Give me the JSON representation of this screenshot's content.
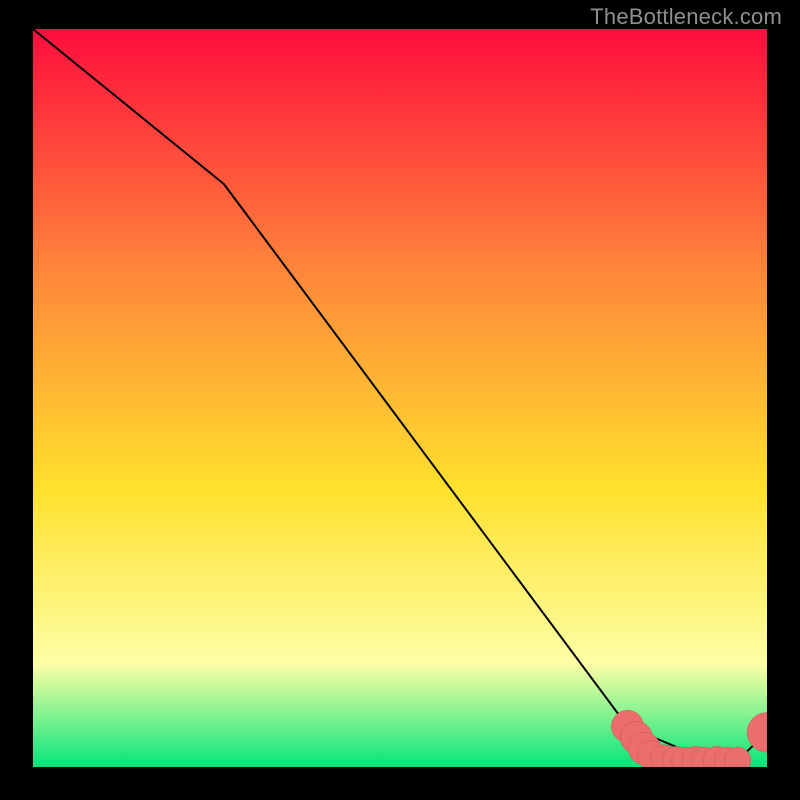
{
  "watermark": "TheBottleneck.com",
  "colors": {
    "gradient_top": "#ff0e3d",
    "gradient_mid_upper": "#ff8d3a",
    "gradient_mid": "#ffe02c",
    "gradient_mid_lower": "#fdffa5",
    "gradient_bottom": "#05e57a",
    "curve": "#000000",
    "marker_fill": "#ec6e6c",
    "marker_stroke": "#c95452",
    "frame_bg": "#000000"
  },
  "chart_data": {
    "type": "line",
    "title": "",
    "xlabel": "",
    "ylabel": "",
    "xlim": [
      0,
      100
    ],
    "ylim": [
      0,
      100
    ],
    "series": [
      {
        "name": "bottleneck-curve",
        "x": [
          0,
          26,
          81,
          92,
          96,
          100
        ],
        "y": [
          100,
          79,
          5.5,
          0.9,
          0.9,
          4.7
        ]
      }
    ],
    "markers": [
      {
        "x": 81.0,
        "y": 5.5,
        "r": 2.2
      },
      {
        "x": 82.2,
        "y": 4.0,
        "r": 2.2
      },
      {
        "x": 83.3,
        "y": 2.5,
        "r": 2.2
      },
      {
        "x": 84.3,
        "y": 1.6,
        "r": 2.0
      },
      {
        "x": 86.0,
        "y": 1.1,
        "r": 1.9
      },
      {
        "x": 87.6,
        "y": 0.9,
        "r": 1.9
      },
      {
        "x": 88.8,
        "y": 0.9,
        "r": 1.8
      },
      {
        "x": 90.3,
        "y": 0.9,
        "r": 1.9
      },
      {
        "x": 91.5,
        "y": 0.9,
        "r": 1.8
      },
      {
        "x": 93.2,
        "y": 0.9,
        "r": 1.9
      },
      {
        "x": 94.6,
        "y": 0.9,
        "r": 1.8
      },
      {
        "x": 96.0,
        "y": 0.9,
        "r": 1.8
      },
      {
        "x": 100.0,
        "y": 4.7,
        "r": 2.7
      }
    ]
  }
}
